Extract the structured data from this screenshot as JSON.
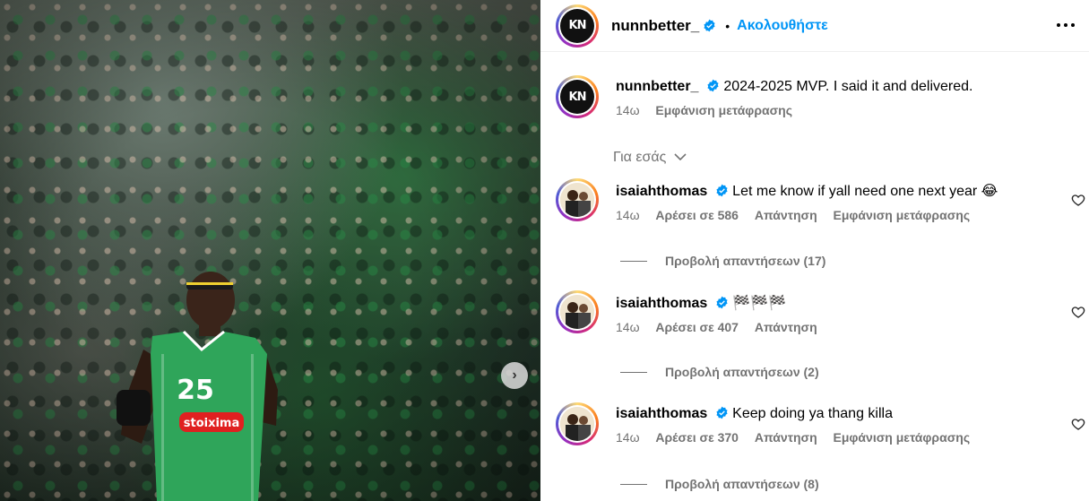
{
  "post": {
    "author": "nunnbetter_",
    "follow_label": "Ακολουθήστε",
    "dot": "•",
    "caption": "2024-2025 MVP. I said it and delivered.",
    "caption_time": "14ω",
    "caption_translate": "Εμφάνιση μετάφρασης",
    "jersey_number": "25",
    "sponsor": "stoixima"
  },
  "filter": {
    "label": "Για εσάς"
  },
  "comments": [
    {
      "user": "isaiahthomas",
      "text": "Let me know if yall need one next year 😂",
      "time": "14ω",
      "likes": "Αρέσει σε 586",
      "reply": "Απάντηση",
      "translate": "Εμφάνιση μετάφρασης",
      "view_replies": "Προβολή απαντήσεων (17)"
    },
    {
      "user": "isaiahthomas",
      "text": "🏁🏁🏁",
      "time": "14ω",
      "likes": "Αρέσει σε 407",
      "reply": "Απάντηση",
      "view_replies": "Προβολή απαντήσεων (2)"
    },
    {
      "user": "isaiahthomas",
      "text": "Keep doing ya thang killa",
      "time": "14ω",
      "likes": "Αρέσει σε 370",
      "reply": "Απάντηση",
      "translate": "Εμφάνιση μετάφρασης",
      "view_replies": "Προβολή απαντήσεων (8)"
    }
  ],
  "colors": {
    "accent": "#0095f6",
    "muted": "#737373",
    "jersey": "#2fa55a"
  },
  "icons": [
    "verified-badge-icon",
    "more-options-icon",
    "heart-icon",
    "chevron-down-icon",
    "next-arrow-icon"
  ]
}
